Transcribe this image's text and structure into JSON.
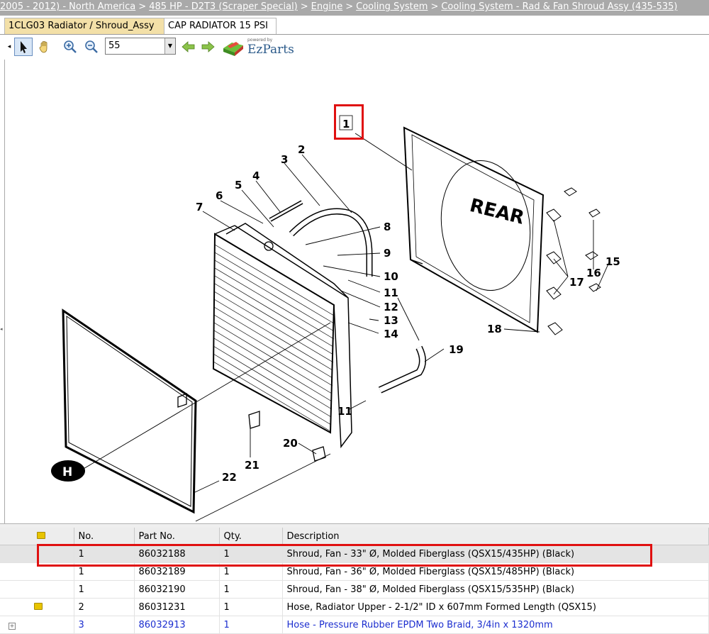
{
  "breadcrumb": [
    "2005 - 2012) - North America",
    "485 HP - D2T3 (Scraper Special)",
    "Engine",
    "Cooling System",
    "Cooling System - Rad & Fan Shroud Assy (435-535)"
  ],
  "tabs": [
    {
      "label": "1CLG03 Radiator / Shroud_Assy",
      "active": true
    },
    {
      "label": "CAP RADIATOR 15 PSI",
      "active": false
    }
  ],
  "toolbar": {
    "zoom_value": "55",
    "logo_powered": "powered by",
    "logo_name": "EzParts"
  },
  "drawing": {
    "callouts": [
      "1",
      "2",
      "3",
      "4",
      "5",
      "6",
      "7",
      "8",
      "9",
      "10",
      "11",
      "12",
      "13",
      "14",
      "15",
      "16",
      "17",
      "18",
      "19",
      "11",
      "20",
      "21",
      "22"
    ],
    "rear_label": "REAR",
    "h_label": "H"
  },
  "table": {
    "headers": {
      "icon": "",
      "no": "No.",
      "part": "Part No.",
      "qty": "Qty.",
      "desc": "Description"
    },
    "rows": [
      {
        "icon": "",
        "no": "1",
        "part": "86032188",
        "qty": "1",
        "desc": "Shroud, Fan - 33\" Ø, Molded Fiberglass (QSX15/435HP) (Black)"
      },
      {
        "icon": "",
        "no": "1",
        "part": "86032189",
        "qty": "1",
        "desc": "Shroud, Fan - 36\" Ø, Molded Fiberglass (QSX15/485HP) (Black)"
      },
      {
        "icon": "",
        "no": "1",
        "part": "86032190",
        "qty": "1",
        "desc": "Shroud, Fan - 38\" Ø, Molded Fiberglass (QSX15/535HP) (Black)"
      },
      {
        "icon": "folder",
        "no": "2",
        "part": "86031231",
        "qty": "1",
        "desc": "Hose, Radiator Upper - 2-1/2\" ID x 607mm Formed Length (QSX15)"
      },
      {
        "icon": "expand",
        "no": "3",
        "part": "86032913",
        "qty": "1",
        "desc": "Hose - Pressure Rubber EPDM Two Braid, 3/4in x 1320mm"
      }
    ]
  },
  "colors": {
    "highlight": "#e01010",
    "link": "#1c2ecf",
    "breadcrumb_bg": "#a9a9a9",
    "active_tab": "#f3e0a8"
  }
}
